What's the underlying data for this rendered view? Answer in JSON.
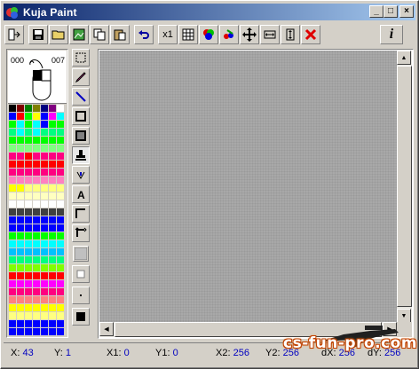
{
  "window": {
    "title": "Kuja Paint"
  },
  "caption_buttons": {
    "minimize": "_",
    "maximize": "□",
    "close": "×"
  },
  "toolbar": {
    "buttons": [
      {
        "name": "import-icon"
      },
      {
        "name": "save-icon"
      },
      {
        "name": "open-icon"
      },
      {
        "name": "image-icon"
      },
      {
        "name": "copy-icon"
      },
      {
        "name": "paste-icon"
      },
      {
        "name": "undo-icon"
      },
      {
        "name": "zoom-x1-button",
        "label": "x1"
      },
      {
        "name": "grid-icon"
      },
      {
        "name": "colors-icon"
      },
      {
        "name": "palette-swap-icon"
      },
      {
        "name": "move-icon"
      },
      {
        "name": "stretch-horizontal-icon"
      },
      {
        "name": "stretch-vertical-icon"
      },
      {
        "name": "clear-icon"
      }
    ],
    "info_label": "i"
  },
  "mouse_panel": {
    "left_value": "000",
    "right_value": "007"
  },
  "palette": {
    "rows": [
      [
        "#000000",
        "#800000",
        "#008000",
        "#808000",
        "#000080",
        "#800080",
        "#ffffff"
      ],
      [
        "#0000ff",
        "#ff0000",
        "#00ff00",
        "#ffff00",
        "#0000ff",
        "#ff00ff",
        "#00ffff"
      ],
      [
        "#00ff00",
        "#00ffff",
        "#00ff00",
        "#00ffff",
        "#0000ff",
        "#00ff00",
        "#00ff00"
      ],
      [
        "#00ff80",
        "#00ffff",
        "#00ff80",
        "#00ffff",
        "#00ff80",
        "#00ff80",
        "#00ff80"
      ],
      [
        "#00ff00",
        "#00ff00",
        "#00ff00",
        "#00ff00",
        "#00ff00",
        "#00ff00",
        "#00ff00"
      ],
      [
        "#80ff80",
        "#80ff80",
        "#80ff80",
        "#80ff80",
        "#80ff80",
        "#80ff80",
        "#80ff80"
      ],
      [
        "#ff0080",
        "#ff0080",
        "#ff0000",
        "#ff0080",
        "#ff0080",
        "#ff0080",
        "#ff0080"
      ],
      [
        "#ff0000",
        "#ff0000",
        "#ff0000",
        "#ff0000",
        "#ff0000",
        "#ff0000",
        "#ff0000"
      ],
      [
        "#ff0080",
        "#ff0080",
        "#ff0080",
        "#ff0080",
        "#ff0080",
        "#ff0080",
        "#ff0080"
      ],
      [
        "#ff80c0",
        "#ff80c0",
        "#ff80c0",
        "#ff80c0",
        "#ff80c0",
        "#ff80c0",
        "#ff80c0"
      ],
      [
        "#ffff00",
        "#ffff00",
        "#ffff80",
        "#ffff80",
        "#ffff80",
        "#ffff80",
        "#ffff80"
      ],
      [
        "#ffffc0",
        "#ffffc0",
        "#ffffc0",
        "#ffffc0",
        "#ffffc0",
        "#ffffc0",
        "#ffffc0"
      ],
      [
        "#ffffff",
        "#ffffff",
        "#ffffff",
        "#ffffff",
        "#ffffff",
        "#ffffff",
        "#ffffff"
      ],
      [
        "#404040",
        "#404040",
        "#404040",
        "#404040",
        "#404040",
        "#404040",
        "#404040"
      ],
      [
        "#0000ff",
        "#0000ff",
        "#0000ff",
        "#0000ff",
        "#0000ff",
        "#0000ff",
        "#0000ff"
      ],
      [
        "#0000ff",
        "#0000ff",
        "#0000ff",
        "#0000ff",
        "#0000ff",
        "#0000ff",
        "#0000ff"
      ],
      [
        "#00ff00",
        "#00ff00",
        "#00ff00",
        "#00ff00",
        "#00ff00",
        "#00ff00",
        "#00ff00"
      ],
      [
        "#00ffff",
        "#00ffff",
        "#00ffff",
        "#00ffff",
        "#00ffff",
        "#00ffff",
        "#00ffff"
      ],
      [
        "#00c0ff",
        "#00c0ff",
        "#00c0ff",
        "#00c0ff",
        "#00c0ff",
        "#00c0ff",
        "#00c0ff"
      ],
      [
        "#00ff80",
        "#00ff80",
        "#00ff80",
        "#00ff80",
        "#00ff80",
        "#00ff80",
        "#00ff80"
      ],
      [
        "#80ff00",
        "#80ff00",
        "#80ff00",
        "#80ff00",
        "#80ff00",
        "#80ff00",
        "#80ff00"
      ],
      [
        "#ff0000",
        "#ff0000",
        "#ff0000",
        "#ff0000",
        "#ff0000",
        "#ff0000",
        "#ff0000"
      ],
      [
        "#ff00ff",
        "#ff00ff",
        "#ff00ff",
        "#ff00ff",
        "#ff00ff",
        "#ff00ff",
        "#ff00ff"
      ],
      [
        "#ff0080",
        "#ff0080",
        "#ff0080",
        "#ff0080",
        "#ff0080",
        "#ff0080",
        "#ff0080"
      ],
      [
        "#ff8080",
        "#ff8080",
        "#ff8080",
        "#ff8080",
        "#ff8080",
        "#ff8080",
        "#ff8080"
      ],
      [
        "#ffff00",
        "#ffff00",
        "#ffff00",
        "#ffff00",
        "#ffff00",
        "#ffff00",
        "#ffff00"
      ],
      [
        "#ffff80",
        "#ffff80",
        "#ffff80",
        "#ffff80",
        "#ffff80",
        "#ffff80",
        "#ffff80"
      ],
      [
        "#0000ff",
        "#0000ff",
        "#0000ff",
        "#0000ff",
        "#0000ff",
        "#0000ff",
        "#0000ff"
      ],
      [
        "#0000ff",
        "#0000ff",
        "#0000ff",
        "#0000ff",
        "#0000ff",
        "#0000ff",
        "#0000ff"
      ]
    ]
  },
  "tools": [
    {
      "name": "select-tool-icon"
    },
    {
      "name": "pencil-tool-icon"
    },
    {
      "name": "line-tool-icon"
    },
    {
      "name": "rectangle-tool-icon"
    },
    {
      "name": "filled-rectangle-tool-icon"
    },
    {
      "name": "stamp-tool-icon",
      "active": true
    },
    {
      "name": "fill-tool-icon"
    },
    {
      "name": "text-tool-icon",
      "label": "A"
    },
    {
      "name": "corner-tool-icon"
    },
    {
      "name": "resize-tool-icon"
    },
    {
      "name": "brush-size-large-icon"
    },
    {
      "name": "brush-size-medium-icon"
    },
    {
      "name": "brush-size-small-icon"
    },
    {
      "name": "brush-size-tiny-icon"
    }
  ],
  "status": {
    "x_label": "X:",
    "x_value": "43",
    "y_label": "Y:",
    "y_value": "1",
    "x1_label": "X1:",
    "x1_value": "0",
    "y1_label": "Y1:",
    "y1_value": "0",
    "x2_label": "X2:",
    "x2_value": "256",
    "y2_label": "Y2:",
    "y2_value": "256",
    "dx_label": "dX:",
    "dx_value": "256",
    "dy_label": "dY:",
    "dy_value": "256"
  },
  "watermark": "cs-fun-pro.com"
}
